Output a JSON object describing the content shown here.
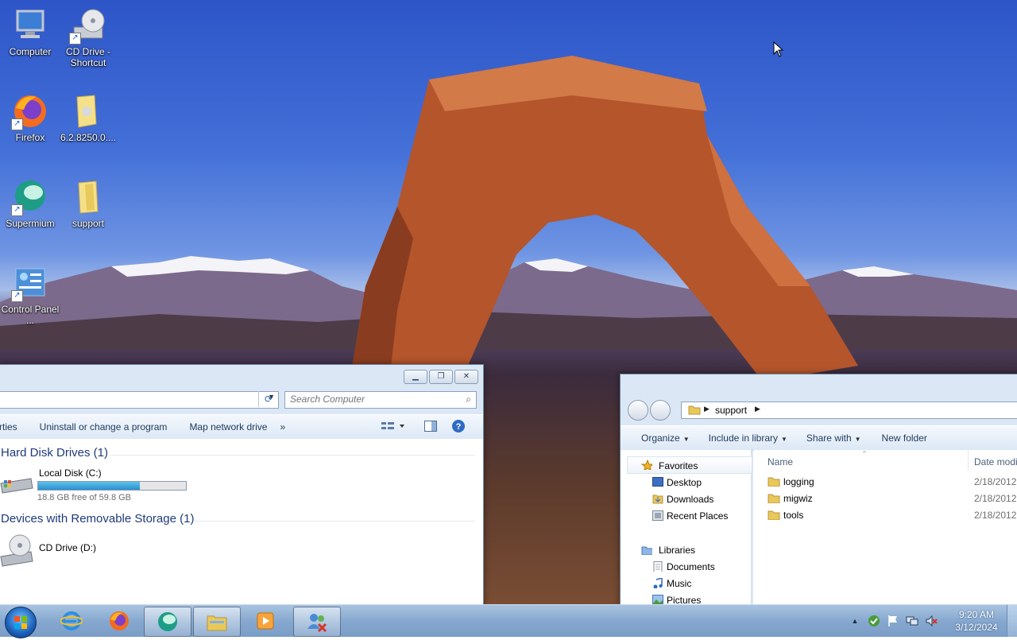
{
  "desktop": {
    "icons": [
      {
        "label": "Computer",
        "icon": "computer-icon"
      },
      {
        "label": "CD Drive - Shortcut",
        "icon": "cd-drive-icon"
      },
      {
        "label": "Firefox",
        "icon": "firefox-icon"
      },
      {
        "label": "6.2.8250.0....",
        "icon": "folder-icon"
      },
      {
        "label": "Supermium",
        "icon": "supermium-icon"
      },
      {
        "label": "support",
        "icon": "folder-icon"
      },
      {
        "label": "Control Panel ...",
        "icon": "control-panel-icon"
      }
    ]
  },
  "computer_window": {
    "search_placeholder": "Search Computer",
    "commands": [
      "rties",
      "Uninstall or change a program",
      "Map network drive",
      "»"
    ],
    "groups": {
      "hdd_title": "Hard Disk Drives (1)",
      "removable_title": "Devices with Removable Storage (1)"
    },
    "local_disk": {
      "name": "Local Disk (C:)",
      "free_text": "18.8 GB free of 59.8 GB",
      "used_fraction": 0.69
    },
    "cd_drive": {
      "name": "CD Drive (D:)"
    }
  },
  "support_window": {
    "breadcrumb": "support",
    "commands": {
      "organize": "Organize",
      "include": "Include in library",
      "share": "Share with",
      "new_folder": "New folder"
    },
    "nav": {
      "favorites": "Favorites",
      "desktop": "Desktop",
      "downloads": "Downloads",
      "recent": "Recent Places",
      "libraries": "Libraries",
      "documents": "Documents",
      "music": "Music",
      "pictures": "Pictures"
    },
    "columns": {
      "name": "Name",
      "date": "Date modi"
    },
    "files": [
      {
        "name": "logging",
        "date": "2/18/2012"
      },
      {
        "name": "migwiz",
        "date": "2/18/2012"
      },
      {
        "name": "tools",
        "date": "2/18/2012"
      }
    ]
  },
  "taskbar": {
    "time": "9:20 AM",
    "date": "3/12/2024",
    "pinned": [
      "start-button",
      "internet-explorer",
      "firefox",
      "supermium",
      "windows-explorer",
      "media-player",
      "user-accounts"
    ]
  }
}
